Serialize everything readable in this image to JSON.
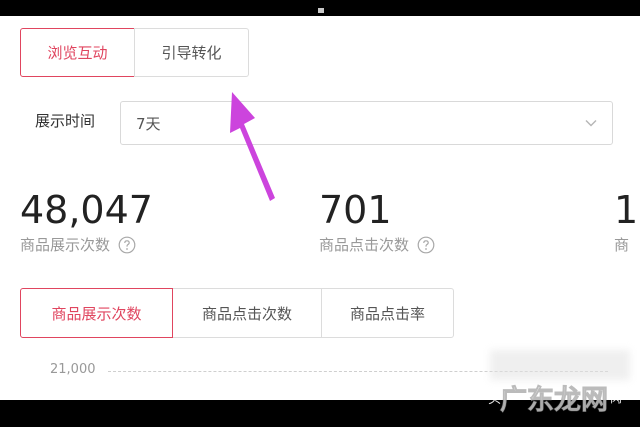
{
  "tabs_top": [
    {
      "label": "浏览互动",
      "active": true
    },
    {
      "label": "引导转化",
      "active": false
    }
  ],
  "time_filter": {
    "label": "展示时间",
    "value": "7天"
  },
  "metrics": [
    {
      "value": "48,047",
      "label": "商品展示次数"
    },
    {
      "value": "701",
      "label": "商品点击次数"
    },
    {
      "value": "1",
      "label": "商"
    }
  ],
  "metric_tabs": [
    {
      "label": "商品展示次数",
      "active": true
    },
    {
      "label": "商品点击次数",
      "active": false
    },
    {
      "label": "商品点击率",
      "active": false
    }
  ],
  "chart": {
    "y_tick": "21,000"
  },
  "watermark": {
    "text": "广东龙网",
    "small_left": "头",
    "small_right": "肉"
  },
  "colors": {
    "accent": "#e0455f",
    "annotation_arrow": "#cc44dd"
  },
  "icons": {
    "help": "question-circle-icon",
    "dropdown": "chevron-down-icon"
  }
}
